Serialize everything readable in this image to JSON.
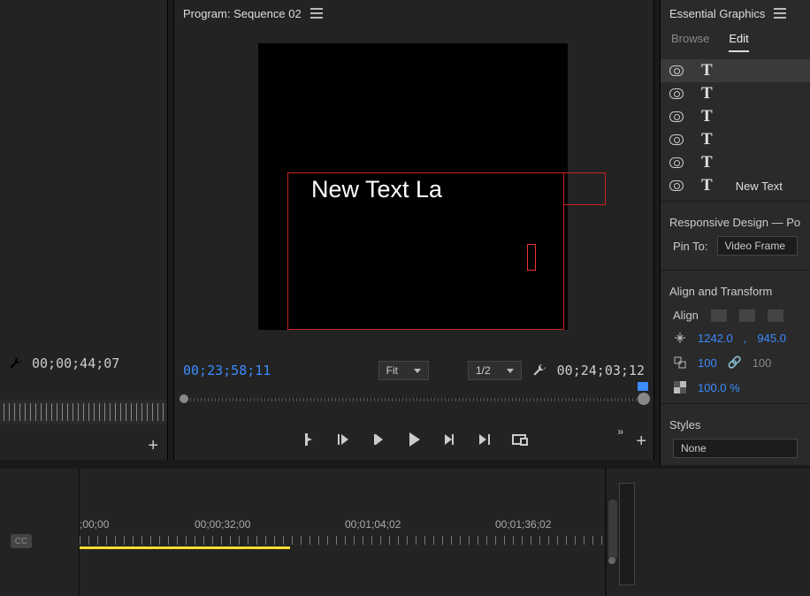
{
  "left": {
    "timecode": "00;00;44;07"
  },
  "program": {
    "title": "Program: Sequence 02",
    "stage_text": "New Text La",
    "tc_in": "00;23;58;11",
    "zoom_label": "Fit",
    "res_label": "1/2",
    "duration": "00;24;03;12"
  },
  "eg": {
    "title": "Essential Graphics",
    "tabs": {
      "browse": "Browse",
      "edit": "Edit"
    },
    "layers": [
      {
        "label": ""
      },
      {
        "label": ""
      },
      {
        "label": ""
      },
      {
        "label": ""
      },
      {
        "label": ""
      },
      {
        "label": "New Text"
      }
    ],
    "responsive": {
      "title": "Responsive Design — Po",
      "pin_label": "Pin To:",
      "pin_value": "Video Frame"
    },
    "align": {
      "title": "Align and Transform",
      "align_label": "Align",
      "pos_x": "1242.0",
      "pos_sep": ",",
      "pos_y": "945.0",
      "scale": "100",
      "scale_h": "100",
      "opacity": "100.0 %"
    },
    "styles": {
      "title": "Styles",
      "value": "None"
    }
  },
  "timeline": {
    "ticks": [
      ";00;00",
      "00;00;32;00",
      "00;01;04;02",
      "00;01;36;02"
    ],
    "cc": "CC"
  }
}
